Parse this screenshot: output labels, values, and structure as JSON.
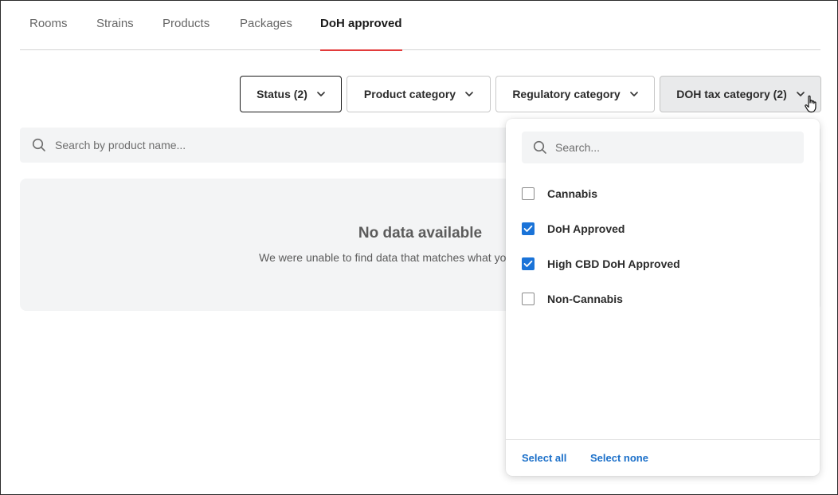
{
  "tabs": [
    {
      "label": "Rooms",
      "active": false
    },
    {
      "label": "Strains",
      "active": false
    },
    {
      "label": "Products",
      "active": false
    },
    {
      "label": "Packages",
      "active": false
    },
    {
      "label": "DoH approved",
      "active": true
    }
  ],
  "filters": {
    "status": {
      "label": "Status (2)",
      "icon": "chevron-down-icon"
    },
    "product_category": {
      "label": "Product category",
      "icon": "chevron-down-icon"
    },
    "regulatory_category": {
      "label": "Regulatory category",
      "icon": "chevron-down-icon"
    },
    "doh_tax_category": {
      "label": "DOH tax category (2)",
      "icon": "chevron-down-icon"
    }
  },
  "search": {
    "placeholder": "Search by product name...",
    "value": "",
    "icon": "search-icon"
  },
  "empty_state": {
    "title": "No data available",
    "message": "We were unable to find data that matches what you're looking for."
  },
  "dropdown": {
    "search_placeholder": "Search...",
    "search_value": "",
    "options": [
      {
        "label": "Cannabis",
        "checked": false
      },
      {
        "label": "DoH Approved",
        "checked": true
      },
      {
        "label": "High CBD DoH Approved",
        "checked": true
      },
      {
        "label": "Non-Cannabis",
        "checked": false
      }
    ],
    "select_all": "Select all",
    "select_none": "Select none"
  },
  "colors": {
    "accent_tab_underline": "#e23b3b",
    "checkbox_checked": "#1a73d8",
    "link": "#1a6fc9",
    "surface_gray": "#f3f4f5"
  }
}
